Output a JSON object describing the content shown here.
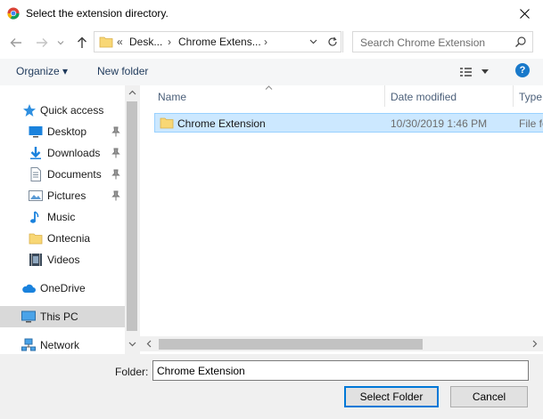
{
  "window": {
    "title": "Select the extension directory."
  },
  "address": {
    "prefix": "«",
    "crumbs": [
      "Desk...",
      "Chrome Extens..."
    ],
    "separator": "›"
  },
  "search": {
    "placeholder": "Search Chrome Extension"
  },
  "toolbar": {
    "organize": "Organize ▾",
    "new_folder": "New folder"
  },
  "nav": {
    "items": [
      {
        "label": "Quick access",
        "icon": "star-icon"
      },
      {
        "label": "Desktop",
        "icon": "desktop-icon",
        "pinned": true
      },
      {
        "label": "Downloads",
        "icon": "download-icon",
        "pinned": true
      },
      {
        "label": "Documents",
        "icon": "documents-icon",
        "pinned": true
      },
      {
        "label": "Pictures",
        "icon": "pictures-icon",
        "pinned": true
      },
      {
        "label": "Music",
        "icon": "music-icon"
      },
      {
        "label": "Ontecnia",
        "icon": "folder-icon"
      },
      {
        "label": "Videos",
        "icon": "videos-icon"
      },
      {
        "label": "OneDrive",
        "icon": "cloud-icon"
      },
      {
        "label": "This PC",
        "icon": "computer-icon",
        "selected": true
      },
      {
        "label": "Network",
        "icon": "network-icon"
      }
    ]
  },
  "columns": {
    "name": "Name",
    "date": "Date modified",
    "type": "Type"
  },
  "files": [
    {
      "name": "Chrome Extension",
      "date": "10/30/2019 1:46 PM",
      "type": "File fo"
    }
  ],
  "footer": {
    "folder_label": "Folder:",
    "folder_value": "Chrome Extension",
    "select_label": "Select Folder",
    "cancel_label": "Cancel"
  }
}
